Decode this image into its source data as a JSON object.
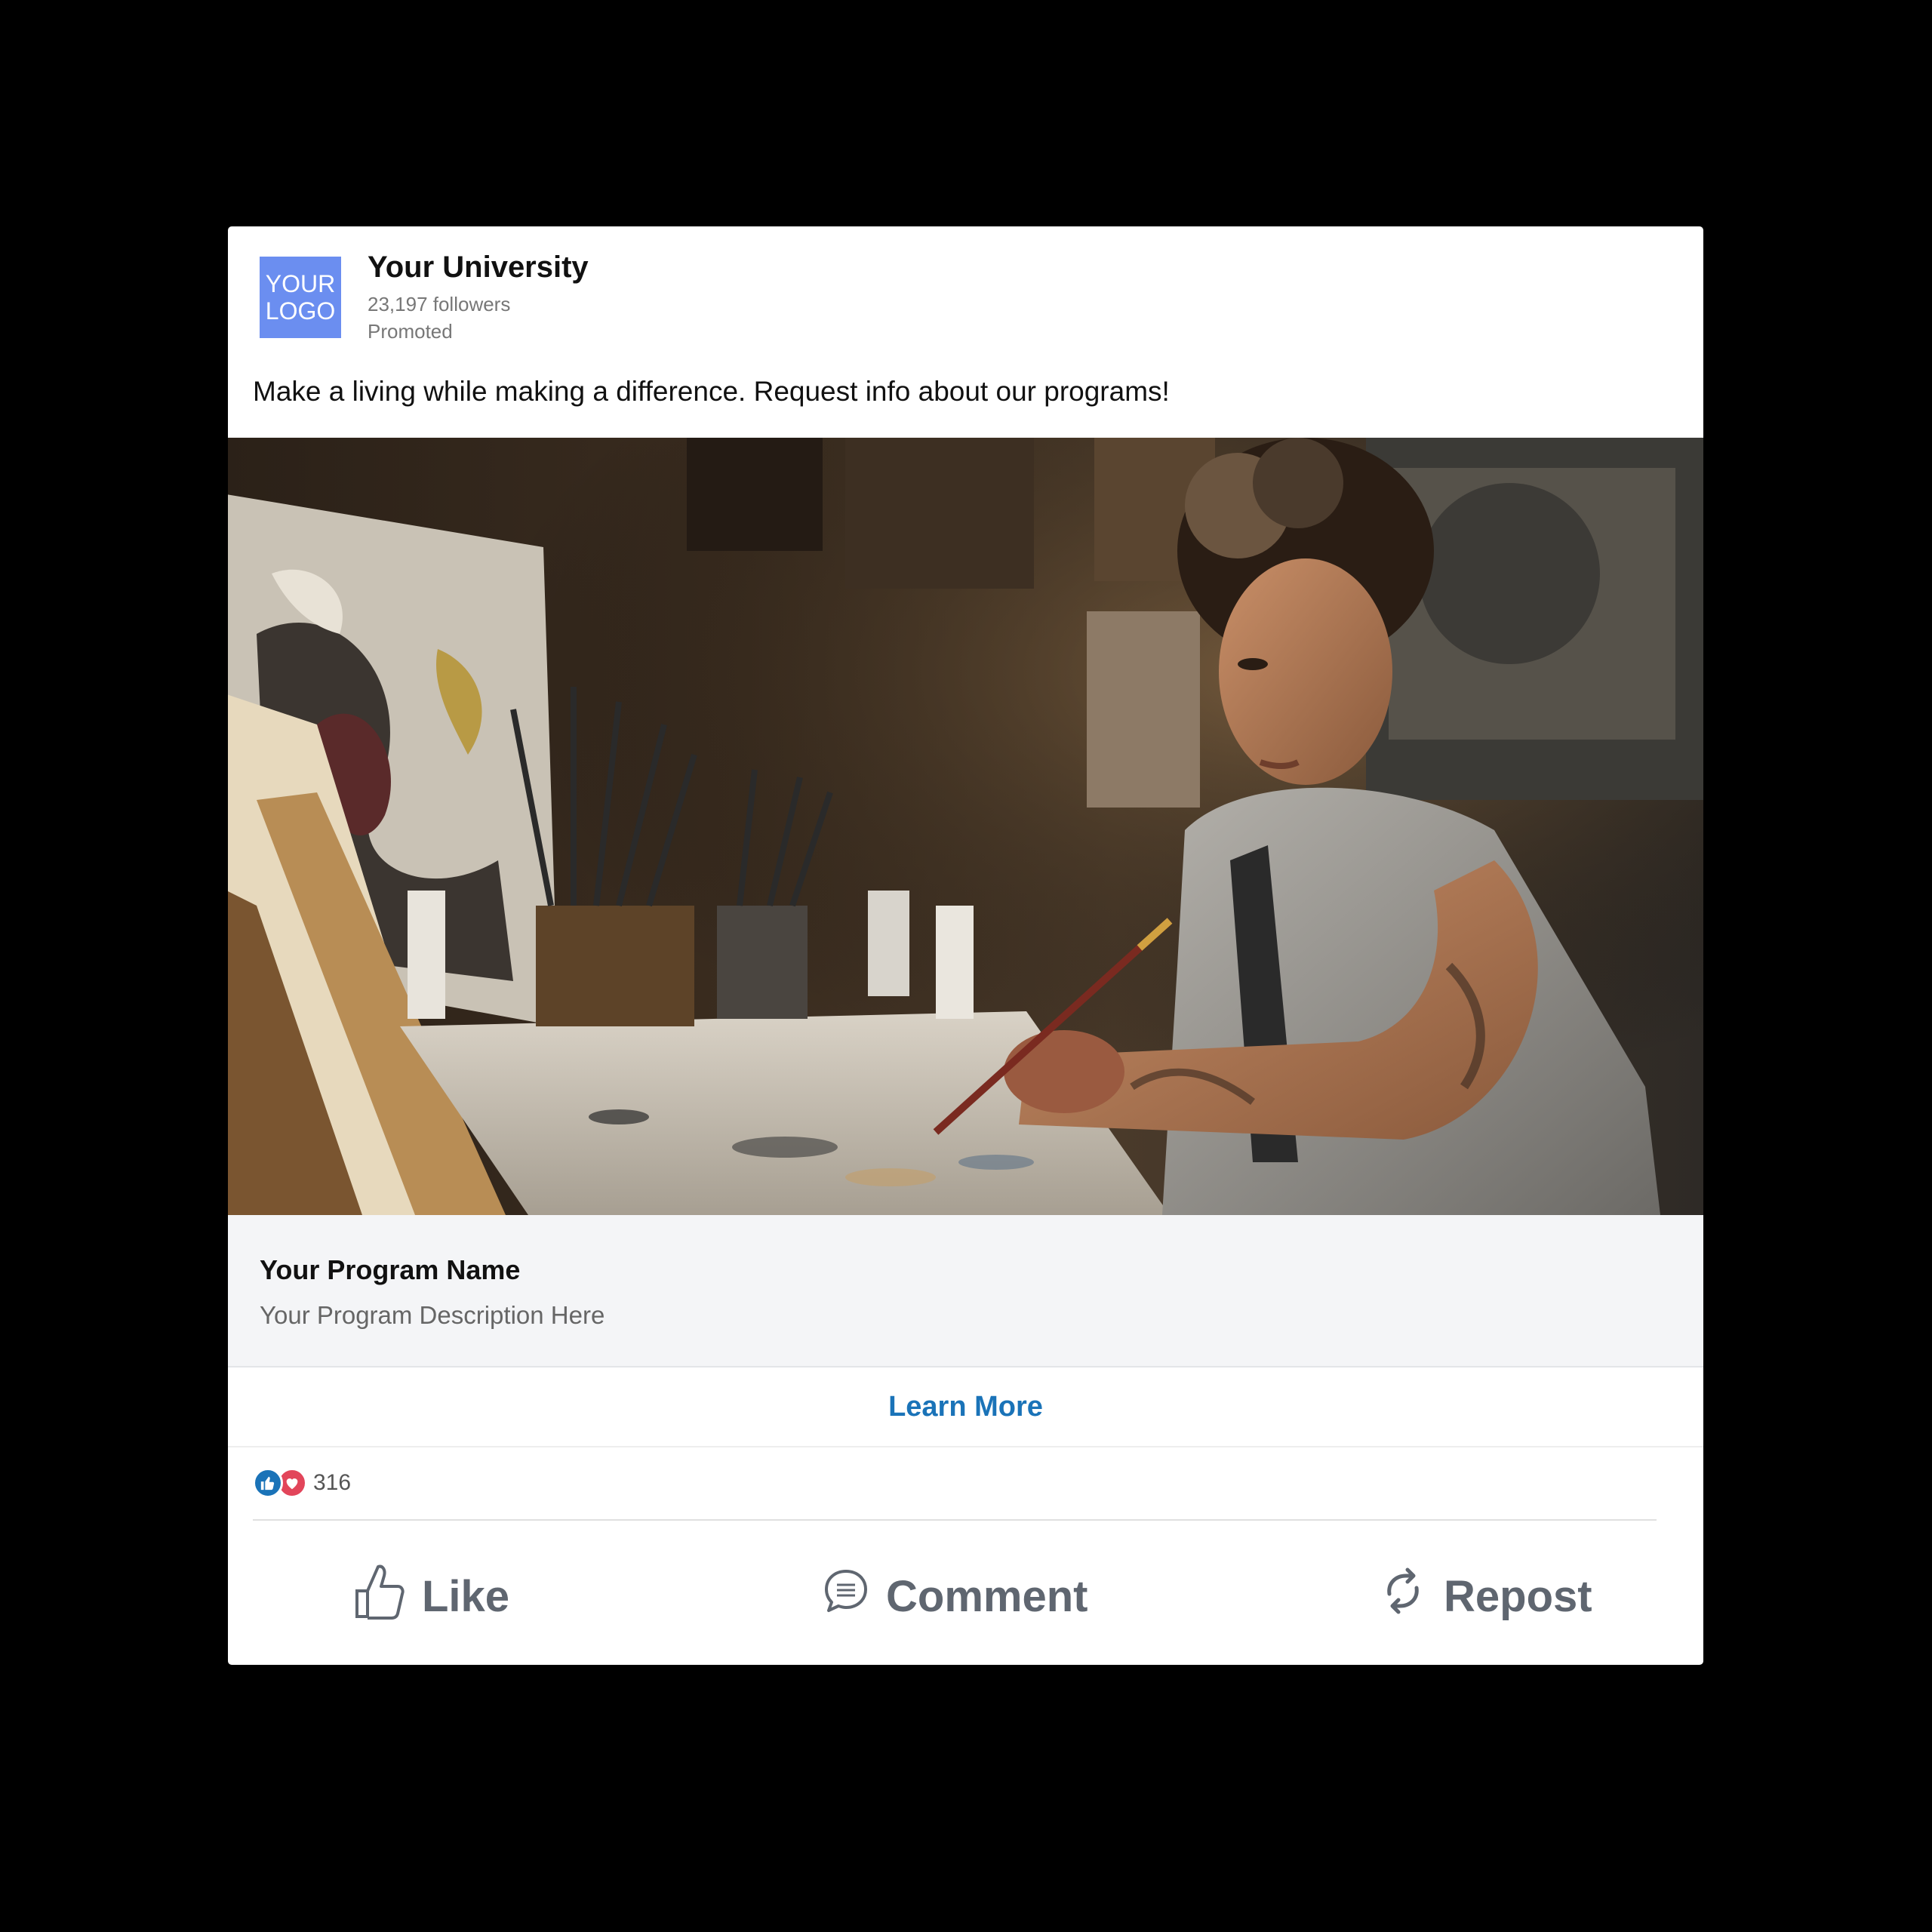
{
  "post": {
    "logo_line1": "YOUR",
    "logo_line2": "LOGO",
    "org_name": "Your University",
    "followers": "23,197 followers",
    "promoted": "Promoted",
    "text": "Make a living while making a difference. Request info about our programs!"
  },
  "program": {
    "name": "Your Program Name",
    "description": "Your Program Description Here"
  },
  "cta": {
    "label": "Learn More"
  },
  "reactions": {
    "count": "316"
  },
  "actions": {
    "like": "Like",
    "comment": "Comment",
    "repost": "Repost"
  },
  "colors": {
    "logo_bg": "#6b8ef0",
    "cta": "#1a73b8",
    "like_reaction": "#1a73b8",
    "heart_reaction": "#e2455a",
    "action_text": "#5f6670"
  },
  "icons": [
    "like-reaction-icon",
    "heart-reaction-icon",
    "thumbs-up-icon",
    "comment-icon",
    "repost-icon"
  ]
}
